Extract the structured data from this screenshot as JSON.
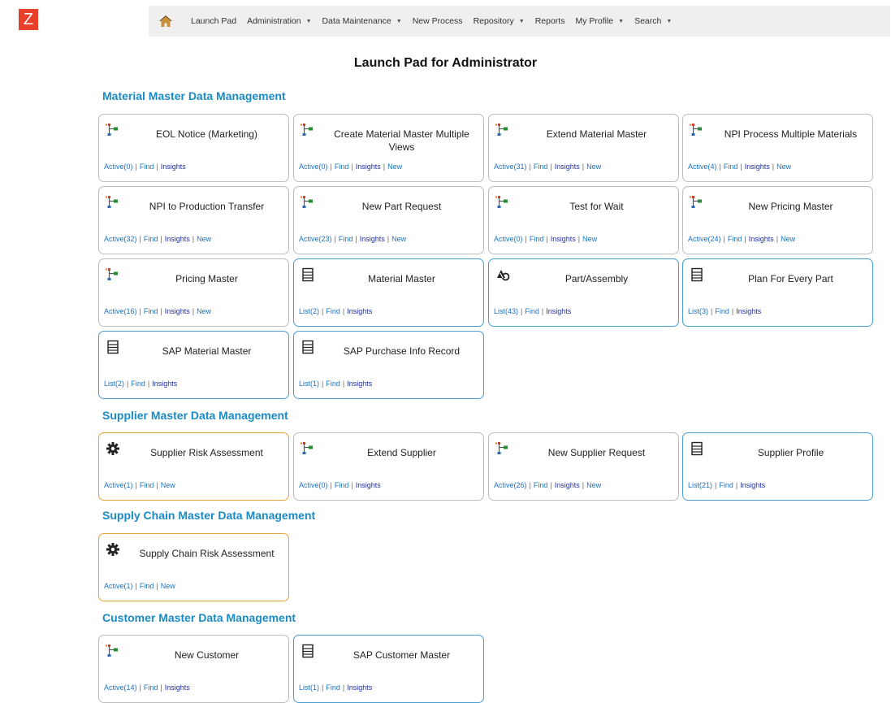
{
  "app": {
    "logo_letter": "Z"
  },
  "nav": {
    "items": [
      {
        "label": "Launch Pad",
        "dropdown": false
      },
      {
        "label": "Administration",
        "dropdown": true
      },
      {
        "label": "Data Maintenance",
        "dropdown": true
      },
      {
        "label": "New Process",
        "dropdown": false
      },
      {
        "label": "Repository",
        "dropdown": true
      },
      {
        "label": "Reports",
        "dropdown": false
      },
      {
        "label": "My Profile",
        "dropdown": true
      },
      {
        "label": "Search",
        "dropdown": true
      }
    ]
  },
  "page": {
    "title": "Launch Pad for Administrator"
  },
  "colors": {
    "accent": "#1a8bc4",
    "logo": "#e8402a",
    "blue_border": "#4a9fd0",
    "orange_border": "#e8a23e",
    "link": "#1a73c2"
  },
  "sections": [
    {
      "title": "Material Master Data Management",
      "cards": [
        {
          "title": "EOL Notice (Marketing)",
          "icon": "workflow-icon",
          "border": "gray",
          "links": [
            "Active(0)",
            "Find",
            "Insights"
          ]
        },
        {
          "title": "Create Material Master Multiple Views",
          "icon": "workflow-icon",
          "border": "gray",
          "links": [
            "Active(0)",
            "Find",
            "Insights",
            "New"
          ]
        },
        {
          "title": "Extend Material Master",
          "icon": "workflow-icon",
          "border": "gray",
          "links": [
            "Active(31)",
            "Find",
            "Insights",
            "New"
          ]
        },
        {
          "title": "NPI Process Multiple Materials",
          "icon": "workflow-icon",
          "border": "gray",
          "links": [
            "Active(4)",
            "Find",
            "Insights",
            "New"
          ]
        },
        {
          "title": "NPI to Production Transfer",
          "icon": "workflow-icon",
          "border": "gray",
          "links": [
            "Active(32)",
            "Find",
            "Insights",
            "New"
          ]
        },
        {
          "title": "New Part Request",
          "icon": "workflow-icon",
          "border": "gray",
          "links": [
            "Active(23)",
            "Find",
            "Insights",
            "New"
          ]
        },
        {
          "title": "Test for Wait",
          "icon": "workflow-icon",
          "border": "gray",
          "links": [
            "Active(0)",
            "Find",
            "Insights",
            "New"
          ]
        },
        {
          "title": "New Pricing Master",
          "icon": "workflow-icon",
          "border": "gray",
          "links": [
            "Active(24)",
            "Find",
            "Insights",
            "New"
          ]
        },
        {
          "title": "Pricing Master",
          "icon": "workflow-icon",
          "border": "gray",
          "links": [
            "Active(16)",
            "Find",
            "Insights",
            "New"
          ]
        },
        {
          "title": "Material Master",
          "icon": "list-icon",
          "border": "blue",
          "links": [
            "List(2)",
            "Find",
            "Insights"
          ]
        },
        {
          "title": "Part/Assembly",
          "icon": "assembly-icon",
          "border": "blue",
          "links": [
            "List(43)",
            "Find",
            "Insights"
          ]
        },
        {
          "title": "Plan For Every Part",
          "icon": "list-icon",
          "border": "blue",
          "links": [
            "List(3)",
            "Find",
            "Insights"
          ]
        },
        {
          "title": "SAP Material Master",
          "icon": "list-icon",
          "border": "blue",
          "links": [
            "List(2)",
            "Find",
            "Insights"
          ]
        },
        {
          "title": "SAP Purchase Info Record",
          "icon": "list-icon",
          "border": "blue",
          "links": [
            "List(1)",
            "Find",
            "Insights"
          ]
        }
      ]
    },
    {
      "title": "Supplier Master Data Management",
      "cards": [
        {
          "title": "Supplier Risk Assessment",
          "icon": "gear-icon",
          "border": "orange",
          "links": [
            "Active(1)",
            "Find",
            "New"
          ]
        },
        {
          "title": "Extend Supplier",
          "icon": "workflow-icon",
          "border": "gray",
          "links": [
            "Active(0)",
            "Find",
            "Insights"
          ]
        },
        {
          "title": "New Supplier Request",
          "icon": "workflow-icon",
          "border": "gray",
          "links": [
            "Active(26)",
            "Find",
            "Insights",
            "New"
          ]
        },
        {
          "title": "Supplier Profile",
          "icon": "list-icon",
          "border": "blue",
          "links": [
            "List(21)",
            "Find",
            "Insights"
          ]
        }
      ]
    },
    {
      "title": "Supply Chain Master Data Management",
      "cards": [
        {
          "title": "Supply Chain Risk Assessment",
          "icon": "gear-icon",
          "border": "orange",
          "links": [
            "Active(1)",
            "Find",
            "New"
          ]
        }
      ]
    },
    {
      "title": "Customer Master Data Management",
      "cards": [
        {
          "title": "New Customer",
          "icon": "workflow-icon",
          "border": "gray",
          "links": [
            "Active(14)",
            "Find",
            "Insights"
          ]
        },
        {
          "title": "SAP Customer Master",
          "icon": "list-icon",
          "border": "blue",
          "links": [
            "List(1)",
            "Find",
            "Insights"
          ]
        }
      ]
    }
  ]
}
